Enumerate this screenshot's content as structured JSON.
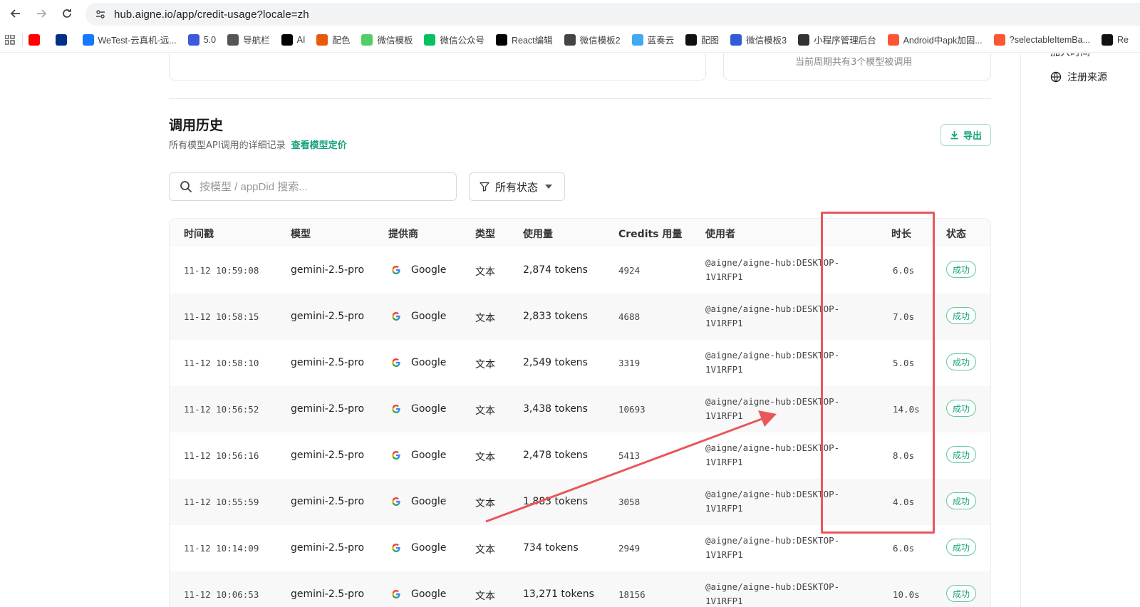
{
  "browser": {
    "url": "hub.aigne.io/app/credit-usage?locale=zh",
    "bookmarks": [
      {
        "label": "",
        "icon": "youtube-icon",
        "color": "#ff0000"
      },
      {
        "label": "",
        "icon": "paypal-icon",
        "color": "#003087"
      },
      {
        "label": "WeTest-云真机-远...",
        "icon": "wetest-icon",
        "color": "#1677ff"
      },
      {
        "label": "5.0",
        "icon": "antd-icon",
        "color": "#3b5bdb"
      },
      {
        "label": "导航栏",
        "icon": "globe-icon",
        "color": "#555555"
      },
      {
        "label": "AI",
        "icon": "k-icon",
        "color": "#000000"
      },
      {
        "label": "配色",
        "icon": "palette-icon",
        "color": "#e8590c"
      },
      {
        "label": "微信模板",
        "icon": "wechat-template-icon",
        "color": "#51cf66"
      },
      {
        "label": "微信公众号",
        "icon": "wechat-icon",
        "color": "#07c160"
      },
      {
        "label": "React编辑",
        "icon": "react-icon",
        "color": "#000000"
      },
      {
        "label": "微信模板2",
        "icon": "m-icon",
        "color": "#444444"
      },
      {
        "label": "蓝奏云",
        "icon": "cloud-icon",
        "color": "#3fa9f5"
      },
      {
        "label": "配图",
        "icon": "openai-icon",
        "color": "#111111"
      },
      {
        "label": "微信模板3",
        "icon": "n-icon",
        "color": "#2f5bd3"
      },
      {
        "label": "小程序管理后台",
        "icon": "mini-program-icon",
        "color": "#333333"
      },
      {
        "label": "Android中apk加固...",
        "icon": "csdn-icon",
        "color": "#fc5531"
      },
      {
        "label": "?selectableItemBa...",
        "icon": "csdn-icon",
        "color": "#fc5531"
      },
      {
        "label": "Re",
        "icon": "github-icon",
        "color": "#111111"
      }
    ]
  },
  "rail": {
    "top_item": "加入时间",
    "register_source": "注册来源"
  },
  "cards": {
    "note": "当前周期共有3个模型被调用"
  },
  "history": {
    "title": "调用历史",
    "subtitle": "所有模型API调用的详细记录",
    "pricing_link": "查看模型定价",
    "export_label": "导出",
    "search_placeholder": "按模型 / appDid 搜索...",
    "status_filter": "所有状态"
  },
  "table": {
    "headers": {
      "timestamp": "时间戳",
      "model": "模型",
      "provider": "提供商",
      "type": "类型",
      "usage": "使用量",
      "credits": "Credits 用量",
      "user": "使用者",
      "duration": "时长",
      "status": "状态"
    },
    "rows": [
      {
        "time": "11-12 10:59:08",
        "model": "gemini-2.5-pro",
        "provider": "Google",
        "type": "文本",
        "usage": "2,874 tokens",
        "credits": "4924",
        "user": "@aigne/aigne-hub:DESKTOP-1V1RFP1",
        "duration": "6.0s",
        "status": "成功"
      },
      {
        "time": "11-12 10:58:15",
        "model": "gemini-2.5-pro",
        "provider": "Google",
        "type": "文本",
        "usage": "2,833 tokens",
        "credits": "4688",
        "user": "@aigne/aigne-hub:DESKTOP-1V1RFP1",
        "duration": "7.0s",
        "status": "成功"
      },
      {
        "time": "11-12 10:58:10",
        "model": "gemini-2.5-pro",
        "provider": "Google",
        "type": "文本",
        "usage": "2,549 tokens",
        "credits": "3319",
        "user": "@aigne/aigne-hub:DESKTOP-1V1RFP1",
        "duration": "5.0s",
        "status": "成功"
      },
      {
        "time": "11-12 10:56:52",
        "model": "gemini-2.5-pro",
        "provider": "Google",
        "type": "文本",
        "usage": "3,438 tokens",
        "credits": "10693",
        "user": "@aigne/aigne-hub:DESKTOP-1V1RFP1",
        "duration": "14.0s",
        "status": "成功"
      },
      {
        "time": "11-12 10:56:16",
        "model": "gemini-2.5-pro",
        "provider": "Google",
        "type": "文本",
        "usage": "2,478 tokens",
        "credits": "5413",
        "user": "@aigne/aigne-hub:DESKTOP-1V1RFP1",
        "duration": "8.0s",
        "status": "成功"
      },
      {
        "time": "11-12 10:55:59",
        "model": "gemini-2.5-pro",
        "provider": "Google",
        "type": "文本",
        "usage": "1,883 tokens",
        "credits": "3058",
        "user": "@aigne/aigne-hub:DESKTOP-1V1RFP1",
        "duration": "4.0s",
        "status": "成功"
      },
      {
        "time": "11-12 10:14:09",
        "model": "gemini-2.5-pro",
        "provider": "Google",
        "type": "文本",
        "usage": "734 tokens",
        "credits": "2949",
        "user": "@aigne/aigne-hub:DESKTOP-1V1RFP1",
        "duration": "6.0s",
        "status": "成功"
      },
      {
        "time": "11-12 10:06:53",
        "model": "gemini-2.5-pro",
        "provider": "Google",
        "type": "文本",
        "usage": "13,271 tokens",
        "credits": "18156",
        "user": "@aigne/aigne-hub:DESKTOP-1V1RFP1",
        "duration": "10.0s",
        "status": "成功"
      }
    ]
  },
  "colors": {
    "accent": "#16a37d",
    "annotation": "#e8575b",
    "success_border": "#62c996"
  }
}
